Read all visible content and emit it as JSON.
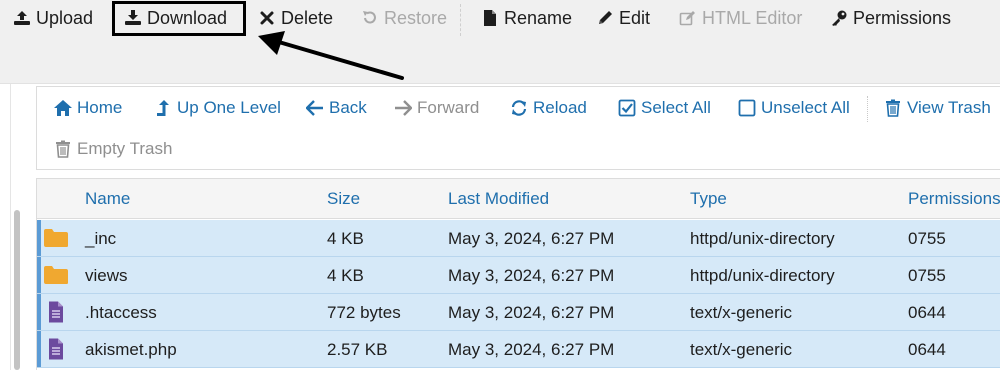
{
  "toolbar": {
    "upload": "Upload",
    "download": "Download",
    "delete": "Delete",
    "restore": "Restore",
    "rename": "Rename",
    "edit": "Edit",
    "html_editor": "HTML Editor",
    "permissions": "Permissions"
  },
  "nav": {
    "home": "Home",
    "up_one_level": "Up One Level",
    "back": "Back",
    "forward": "Forward",
    "reload": "Reload",
    "select_all": "Select All",
    "unselect_all": "Unselect All",
    "view_trash": "View Trash",
    "empty_trash": "Empty Trash"
  },
  "table": {
    "headers": {
      "name": "Name",
      "size": "Size",
      "last_modified": "Last Modified",
      "type": "Type",
      "permissions": "Permissions"
    },
    "rows": [
      {
        "icon": "folder-icon",
        "name": "_inc",
        "size": "4 KB",
        "modified": "May 3, 2024, 6:27 PM",
        "type": "httpd/unix-directory",
        "perms": "0755"
      },
      {
        "icon": "folder-icon",
        "name": "views",
        "size": "4 KB",
        "modified": "May 3, 2024, 6:27 PM",
        "type": "httpd/unix-directory",
        "perms": "0755"
      },
      {
        "icon": "file-text-icon",
        "name": ".htaccess",
        "size": "772 bytes",
        "modified": "May 3, 2024, 6:27 PM",
        "type": "text/x-generic",
        "perms": "0644"
      },
      {
        "icon": "file-text-icon",
        "name": "akismet.php",
        "size": "2.57 KB",
        "modified": "May 3, 2024, 6:27 PM",
        "type": "text/x-generic",
        "perms": "0644"
      }
    ]
  },
  "colors": {
    "link_blue": "#1f6fad",
    "row_selected": "#d6e9f8",
    "folder": "#f0a830",
    "file": "#6c4a9e",
    "annotation": "#000000"
  }
}
